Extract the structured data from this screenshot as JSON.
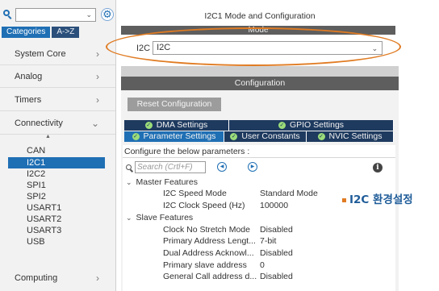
{
  "sidebar": {
    "tabs": [
      "Categories",
      "A->Z"
    ],
    "categories": [
      {
        "label": "System Core"
      },
      {
        "label": "Analog"
      },
      {
        "label": "Timers"
      },
      {
        "label": "Connectivity"
      }
    ],
    "peripherals": [
      "CAN",
      "I2C1",
      "I2C2",
      "SPI1",
      "SPI2",
      "USART1",
      "USART2",
      "USART3",
      "USB"
    ],
    "selected_peripheral": "I2C1",
    "bottom_category": "Computing"
  },
  "main": {
    "title": "I2C1 Mode and Configuration",
    "mode": {
      "header": "Mode",
      "field_label": "I2C",
      "field_value": "I2C"
    },
    "configuration": {
      "header": "Configuration",
      "reset_button": "Reset Configuration",
      "tabs_top": [
        "DMA Settings",
        "GPIO Settings"
      ],
      "tabs_bottom": [
        "Parameter Settings",
        "User Constants",
        "NVIC Settings"
      ],
      "active_tab": "Parameter Settings",
      "configure_text": "Configure the below parameters :",
      "search_placeholder": "Search (Crtl+F)",
      "groups": [
        {
          "title": "Master Features",
          "params": [
            {
              "name": "I2C Speed Mode",
              "value": "Standard Mode"
            },
            {
              "name": "I2C Clock Speed (Hz)",
              "value": "100000"
            }
          ]
        },
        {
          "title": "Slave Features",
          "params": [
            {
              "name": "Clock No Stretch Mode",
              "value": "Disabled"
            },
            {
              "name": "Primary Address Lengt...",
              "value": "7-bit"
            },
            {
              "name": "Dual Address Acknowl...",
              "value": "Disabled"
            },
            {
              "name": "Primary slave address",
              "value": "0"
            },
            {
              "name": "General Call address d...",
              "value": "Disabled"
            }
          ]
        }
      ]
    }
  },
  "annotation": "I2C 환경설정",
  "colors": {
    "accent_blue": "#1f6fb4",
    "dark_navy": "#1e3a5f",
    "highlight_orange": "#e07b22",
    "annotation_blue": "#1f5c99"
  }
}
